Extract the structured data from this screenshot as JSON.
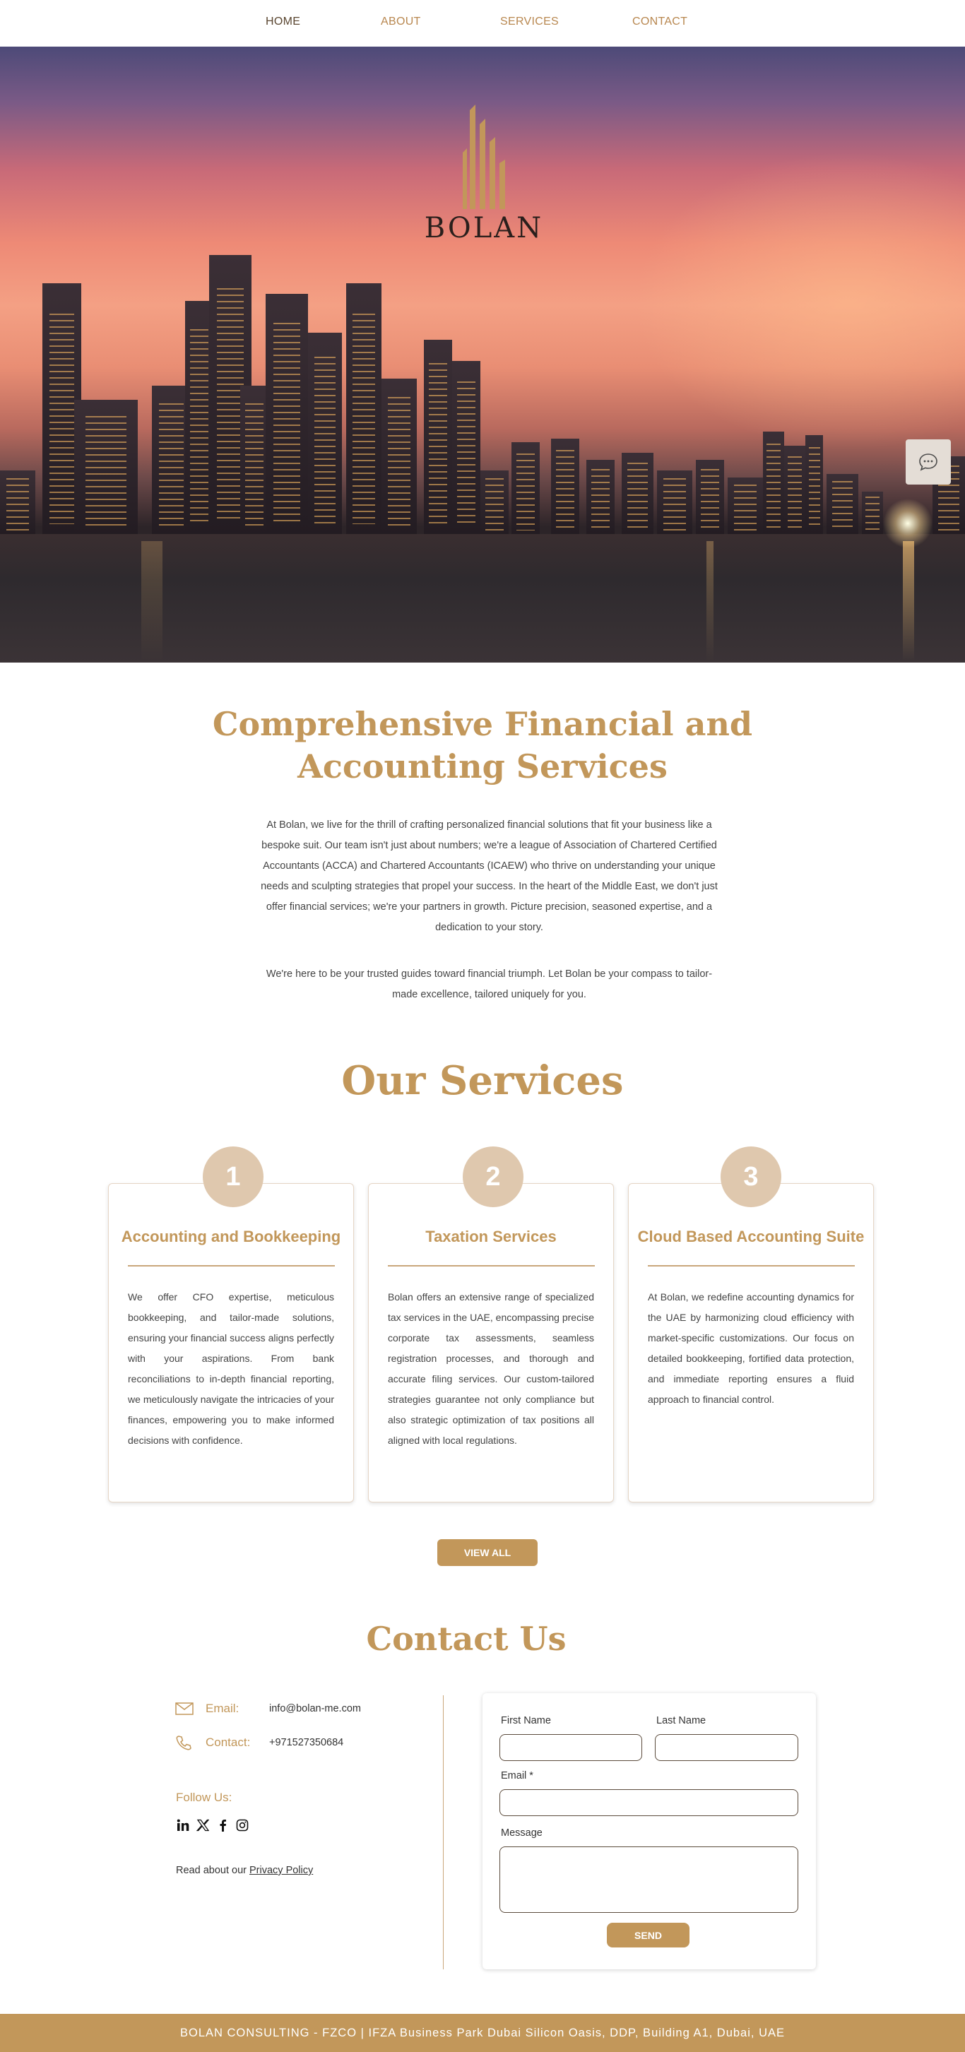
{
  "nav": {
    "items": [
      "HOME",
      "ABOUT",
      "SERVICES",
      "CONTACT"
    ],
    "active": "HOME"
  },
  "hero": {
    "logo_text": "BOLAN",
    "chat_icon": "chat-bubble-icon"
  },
  "intro": {
    "title": "Comprehensive Financial and Accounting Services",
    "p1": "At Bolan, we live for the thrill of crafting personalized financial solutions that fit your business like a bespoke suit. Our team isn't just about numbers; we're a league of Association of Chartered Certified Accountants (ACCA) and Chartered Accountants (ICAEW) who thrive on understanding your unique needs and sculpting strategies that propel your success. In the heart of the Middle East, we don't just offer financial services; we're your partners in growth. Picture precision, seasoned expertise, and a dedication to your story.",
    "p2": "We're here to be your trusted guides toward financial triumph. Let Bolan be your compass to tailor-made excellence, tailored uniquely for you."
  },
  "services": {
    "title": "Our Services",
    "cards": [
      {
        "number": "1",
        "title": "Accounting and Bookkeeping",
        "text": "We offer CFO expertise, meticulous bookkeeping, and tailor-made solutions, ensuring your financial success aligns perfectly with your aspirations. From bank reconciliations to in-depth financial reporting, we meticulously navigate the intricacies of your finances, empowering you to make informed decisions with confidence."
      },
      {
        "number": "2",
        "title": "Taxation Services",
        "text": "Bolan offers an extensive range of specialized tax services in the UAE, encompassing precise corporate tax assessments, seamless registration processes, and thorough and accurate filing services. Our custom-tailored strategies guarantee not only compliance but also strategic optimization of tax positions all aligned with local regulations."
      },
      {
        "number": "3",
        "title": "Cloud Based Accounting Suite",
        "text": "At Bolan, we redefine accounting dynamics for the UAE by harmonizing cloud efficiency with market-specific customizations. Our focus on detailed bookkeeping, fortified data protection, and immediate reporting ensures a fluid approach to financial control."
      }
    ],
    "view_all": "VIEW ALL"
  },
  "contact": {
    "title": "Contact Us",
    "email_label": "Email:",
    "email_value": "info@bolan-me.com",
    "phone_label": "Contact:",
    "phone_value": "+971527350684",
    "follow_label": "Follow Us:",
    "socials": [
      "linkedin-icon",
      "x-icon",
      "facebook-icon",
      "instagram-icon"
    ],
    "privacy_prefix": "Read about our ",
    "privacy_link": "Privacy Policy",
    "form": {
      "first_name": "First Name",
      "last_name": "Last Name",
      "email": "Email *",
      "message": "Message",
      "send": "SEND"
    }
  },
  "footer": {
    "text": "BOLAN CONSULTING - FZCO | IFZA Business Park Dubai Silicon Oasis, DDP, Building A1, Dubai, UAE"
  },
  "colors": {
    "accent": "#c2975a",
    "badge": "#dfc8ae",
    "nav_active": "#5a4630"
  }
}
